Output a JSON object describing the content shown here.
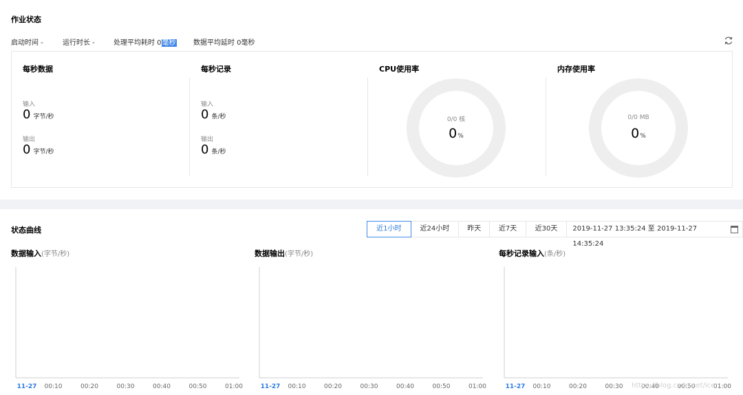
{
  "job_status": {
    "title": "作业状态",
    "start_time_label": "启动时间 -",
    "run_duration_label": "运行时长 -",
    "avg_processing_prefix": "处理平均耗时 0",
    "avg_processing_unit": "毫秒",
    "avg_latency_label": "数据平均延时 0毫秒"
  },
  "metrics": {
    "per_sec_data": {
      "title": "每秒数据",
      "input_label": "输入",
      "input_value": "0",
      "input_unit": "字节/秒",
      "output_label": "输出",
      "output_value": "0",
      "output_unit": "字节/秒"
    },
    "per_sec_records": {
      "title": "每秒记录",
      "input_label": "输入",
      "input_value": "0",
      "input_unit": "条/秒",
      "output_label": "输出",
      "output_value": "0",
      "output_unit": "条/秒"
    },
    "cpu": {
      "title": "CPU使用率",
      "sub": "0/0 核",
      "value": "0",
      "unit": "%"
    },
    "memory": {
      "title": "内存使用率",
      "sub": "0/0 MB",
      "value": "0",
      "unit": "%"
    }
  },
  "status_curves": {
    "title": "状态曲线",
    "ranges": [
      "近1小时",
      "近24小时",
      "昨天",
      "近7天",
      "近30天"
    ],
    "active_range": "近1小时",
    "date_range": "2019-11-27 13:35:24 至 2019-11-27 14:35:24"
  },
  "charts": [
    {
      "title": "数据输入",
      "unit": "(字节/秒)"
    },
    {
      "title": "数据输出",
      "unit": "(字节/秒)"
    },
    {
      "title": "每秒记录输入",
      "unit": "(条/秒)"
    }
  ],
  "chart_data": [
    {
      "type": "line",
      "title": "数据输入(字节/秒)",
      "x": [
        "11-27",
        "00:10",
        "00:20",
        "00:30",
        "00:40",
        "00:50",
        "01:00"
      ],
      "series": []
    },
    {
      "type": "line",
      "title": "数据输出(字节/秒)",
      "x": [
        "11-27",
        "00:10",
        "00:20",
        "00:30",
        "00:40",
        "00:50",
        "01:00"
      ],
      "series": []
    },
    {
      "type": "line",
      "title": "每秒记录输入(条/秒)",
      "x": [
        "11-27",
        "00:10",
        "00:20",
        "00:30",
        "00:40",
        "00:50",
        "01:00"
      ],
      "series": []
    }
  ],
  "watermark": "https://blog.csdn.net/ice"
}
